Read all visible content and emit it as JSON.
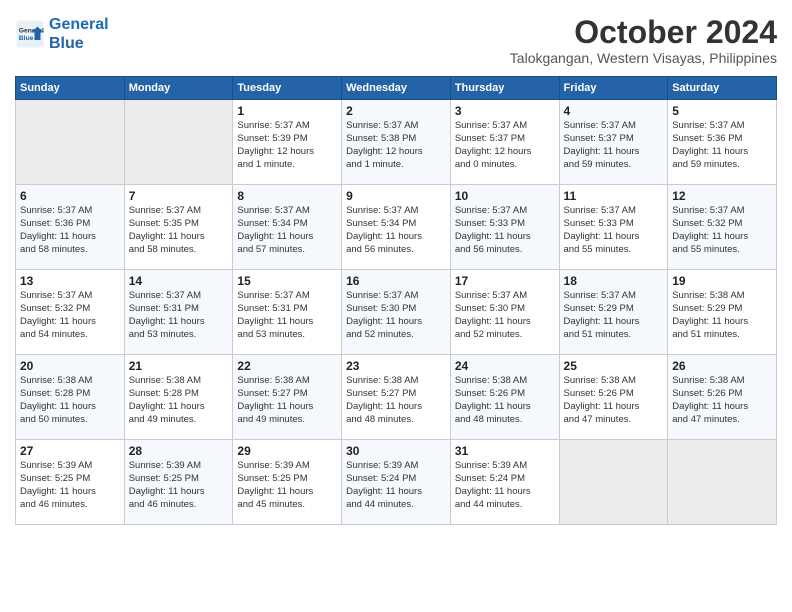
{
  "header": {
    "logo_line1": "General",
    "logo_line2": "Blue",
    "month_title": "October 2024",
    "location": "Talokgangan, Western Visayas, Philippines"
  },
  "weekdays": [
    "Sunday",
    "Monday",
    "Tuesday",
    "Wednesday",
    "Thursday",
    "Friday",
    "Saturday"
  ],
  "weeks": [
    [
      {
        "day": "",
        "info": ""
      },
      {
        "day": "",
        "info": ""
      },
      {
        "day": "1",
        "info": "Sunrise: 5:37 AM\nSunset: 5:39 PM\nDaylight: 12 hours\nand 1 minute."
      },
      {
        "day": "2",
        "info": "Sunrise: 5:37 AM\nSunset: 5:38 PM\nDaylight: 12 hours\nand 1 minute."
      },
      {
        "day": "3",
        "info": "Sunrise: 5:37 AM\nSunset: 5:37 PM\nDaylight: 12 hours\nand 0 minutes."
      },
      {
        "day": "4",
        "info": "Sunrise: 5:37 AM\nSunset: 5:37 PM\nDaylight: 11 hours\nand 59 minutes."
      },
      {
        "day": "5",
        "info": "Sunrise: 5:37 AM\nSunset: 5:36 PM\nDaylight: 11 hours\nand 59 minutes."
      }
    ],
    [
      {
        "day": "6",
        "info": "Sunrise: 5:37 AM\nSunset: 5:36 PM\nDaylight: 11 hours\nand 58 minutes."
      },
      {
        "day": "7",
        "info": "Sunrise: 5:37 AM\nSunset: 5:35 PM\nDaylight: 11 hours\nand 58 minutes."
      },
      {
        "day": "8",
        "info": "Sunrise: 5:37 AM\nSunset: 5:34 PM\nDaylight: 11 hours\nand 57 minutes."
      },
      {
        "day": "9",
        "info": "Sunrise: 5:37 AM\nSunset: 5:34 PM\nDaylight: 11 hours\nand 56 minutes."
      },
      {
        "day": "10",
        "info": "Sunrise: 5:37 AM\nSunset: 5:33 PM\nDaylight: 11 hours\nand 56 minutes."
      },
      {
        "day": "11",
        "info": "Sunrise: 5:37 AM\nSunset: 5:33 PM\nDaylight: 11 hours\nand 55 minutes."
      },
      {
        "day": "12",
        "info": "Sunrise: 5:37 AM\nSunset: 5:32 PM\nDaylight: 11 hours\nand 55 minutes."
      }
    ],
    [
      {
        "day": "13",
        "info": "Sunrise: 5:37 AM\nSunset: 5:32 PM\nDaylight: 11 hours\nand 54 minutes."
      },
      {
        "day": "14",
        "info": "Sunrise: 5:37 AM\nSunset: 5:31 PM\nDaylight: 11 hours\nand 53 minutes."
      },
      {
        "day": "15",
        "info": "Sunrise: 5:37 AM\nSunset: 5:31 PM\nDaylight: 11 hours\nand 53 minutes."
      },
      {
        "day": "16",
        "info": "Sunrise: 5:37 AM\nSunset: 5:30 PM\nDaylight: 11 hours\nand 52 minutes."
      },
      {
        "day": "17",
        "info": "Sunrise: 5:37 AM\nSunset: 5:30 PM\nDaylight: 11 hours\nand 52 minutes."
      },
      {
        "day": "18",
        "info": "Sunrise: 5:37 AM\nSunset: 5:29 PM\nDaylight: 11 hours\nand 51 minutes."
      },
      {
        "day": "19",
        "info": "Sunrise: 5:38 AM\nSunset: 5:29 PM\nDaylight: 11 hours\nand 51 minutes."
      }
    ],
    [
      {
        "day": "20",
        "info": "Sunrise: 5:38 AM\nSunset: 5:28 PM\nDaylight: 11 hours\nand 50 minutes."
      },
      {
        "day": "21",
        "info": "Sunrise: 5:38 AM\nSunset: 5:28 PM\nDaylight: 11 hours\nand 49 minutes."
      },
      {
        "day": "22",
        "info": "Sunrise: 5:38 AM\nSunset: 5:27 PM\nDaylight: 11 hours\nand 49 minutes."
      },
      {
        "day": "23",
        "info": "Sunrise: 5:38 AM\nSunset: 5:27 PM\nDaylight: 11 hours\nand 48 minutes."
      },
      {
        "day": "24",
        "info": "Sunrise: 5:38 AM\nSunset: 5:26 PM\nDaylight: 11 hours\nand 48 minutes."
      },
      {
        "day": "25",
        "info": "Sunrise: 5:38 AM\nSunset: 5:26 PM\nDaylight: 11 hours\nand 47 minutes."
      },
      {
        "day": "26",
        "info": "Sunrise: 5:38 AM\nSunset: 5:26 PM\nDaylight: 11 hours\nand 47 minutes."
      }
    ],
    [
      {
        "day": "27",
        "info": "Sunrise: 5:39 AM\nSunset: 5:25 PM\nDaylight: 11 hours\nand 46 minutes."
      },
      {
        "day": "28",
        "info": "Sunrise: 5:39 AM\nSunset: 5:25 PM\nDaylight: 11 hours\nand 46 minutes."
      },
      {
        "day": "29",
        "info": "Sunrise: 5:39 AM\nSunset: 5:25 PM\nDaylight: 11 hours\nand 45 minutes."
      },
      {
        "day": "30",
        "info": "Sunrise: 5:39 AM\nSunset: 5:24 PM\nDaylight: 11 hours\nand 44 minutes."
      },
      {
        "day": "31",
        "info": "Sunrise: 5:39 AM\nSunset: 5:24 PM\nDaylight: 11 hours\nand 44 minutes."
      },
      {
        "day": "",
        "info": ""
      },
      {
        "day": "",
        "info": ""
      }
    ]
  ]
}
